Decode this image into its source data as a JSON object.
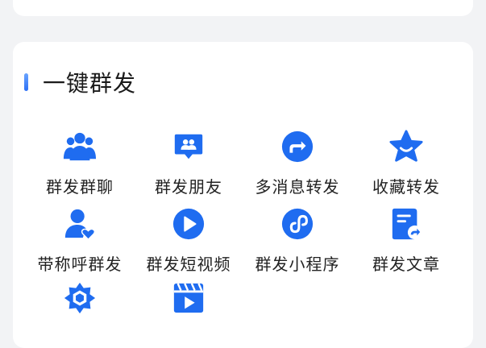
{
  "section": {
    "title": "一键群发"
  },
  "theme": {
    "accent": "#2c6ff5",
    "icon_blue": "#1f6cf0"
  },
  "items": [
    {
      "label": "群发群聊",
      "icon": "group-chat-icon"
    },
    {
      "label": "群发朋友",
      "icon": "friends-message-icon"
    },
    {
      "label": "多消息转发",
      "icon": "forward-icon"
    },
    {
      "label": "收藏转发",
      "icon": "favorite-star-icon"
    },
    {
      "label": "带称呼群发",
      "icon": "user-heart-icon"
    },
    {
      "label": "群发短视频",
      "icon": "play-video-icon"
    },
    {
      "label": "群发小程序",
      "icon": "mini-program-icon"
    },
    {
      "label": "群发文章",
      "icon": "article-icon"
    },
    {
      "label": "",
      "icon": "hexagon-star-icon"
    },
    {
      "label": "",
      "icon": "video-clapper-icon"
    }
  ]
}
